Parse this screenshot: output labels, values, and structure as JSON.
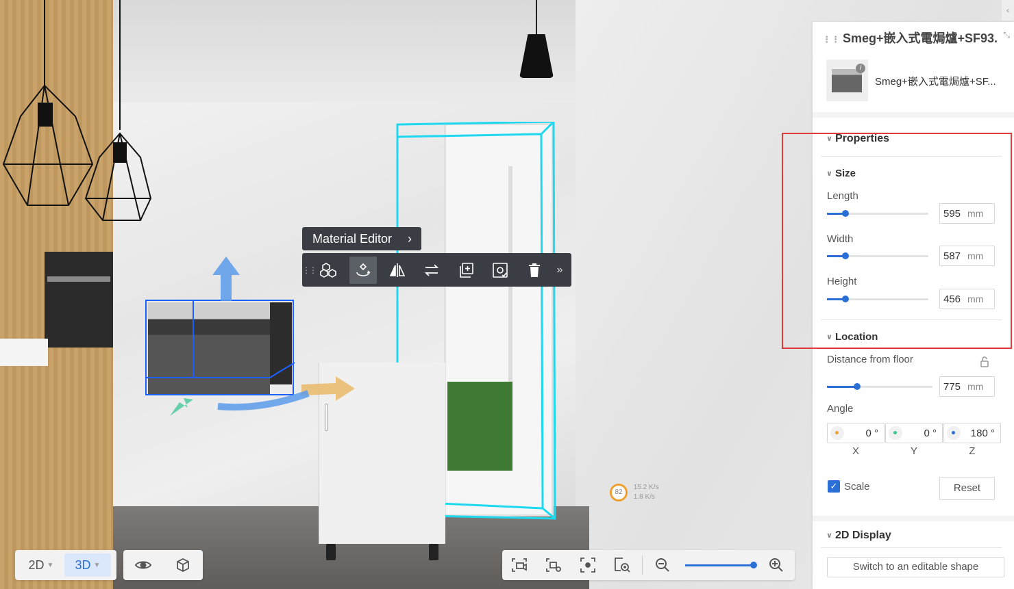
{
  "toolbar_popup": {
    "material_editor_label": "Material Editor",
    "tools": [
      "group-tool",
      "rotate-move-tool",
      "mirror-tool",
      "replace-tool",
      "copy-tool",
      "favorite-tool",
      "delete-tool"
    ]
  },
  "stats": {
    "score": "82",
    "upload": "15.2 K/s",
    "download": "1.8 K/s"
  },
  "bottom_toolbar": {
    "view_2d": "2D",
    "view_3d": "3D",
    "zoom_level": 1.0
  },
  "panel": {
    "title": "Smeg+嵌入式電焗爐+SF93...",
    "product_name": "Smeg+嵌入式電焗爐+SF...",
    "properties_label": "Properties",
    "size_label": "Size",
    "length_label": "Length",
    "length_value": "595",
    "width_label": "Width",
    "width_value": "587",
    "height_label": "Height",
    "height_value": "456",
    "unit": "mm",
    "location_label": "Location",
    "distance_label": "Distance from floor",
    "distance_value": "775",
    "angle_label": "Angle",
    "angle_x": "0 °",
    "angle_y": "0 °",
    "angle_z": "180 °",
    "axis_x": "X",
    "axis_y": "Y",
    "axis_z": "Z",
    "scale_label": "Scale",
    "scale_checked": true,
    "reset_label": "Reset",
    "display_2d_label": "2D Display",
    "editable_shape_label": "Switch to an editable shape"
  },
  "colors": {
    "accent": "#2a6fd6",
    "highlight_frame": "#e03a3a",
    "selection_cyan": "#1ed8f0",
    "selection_blue": "#1d5fff"
  }
}
